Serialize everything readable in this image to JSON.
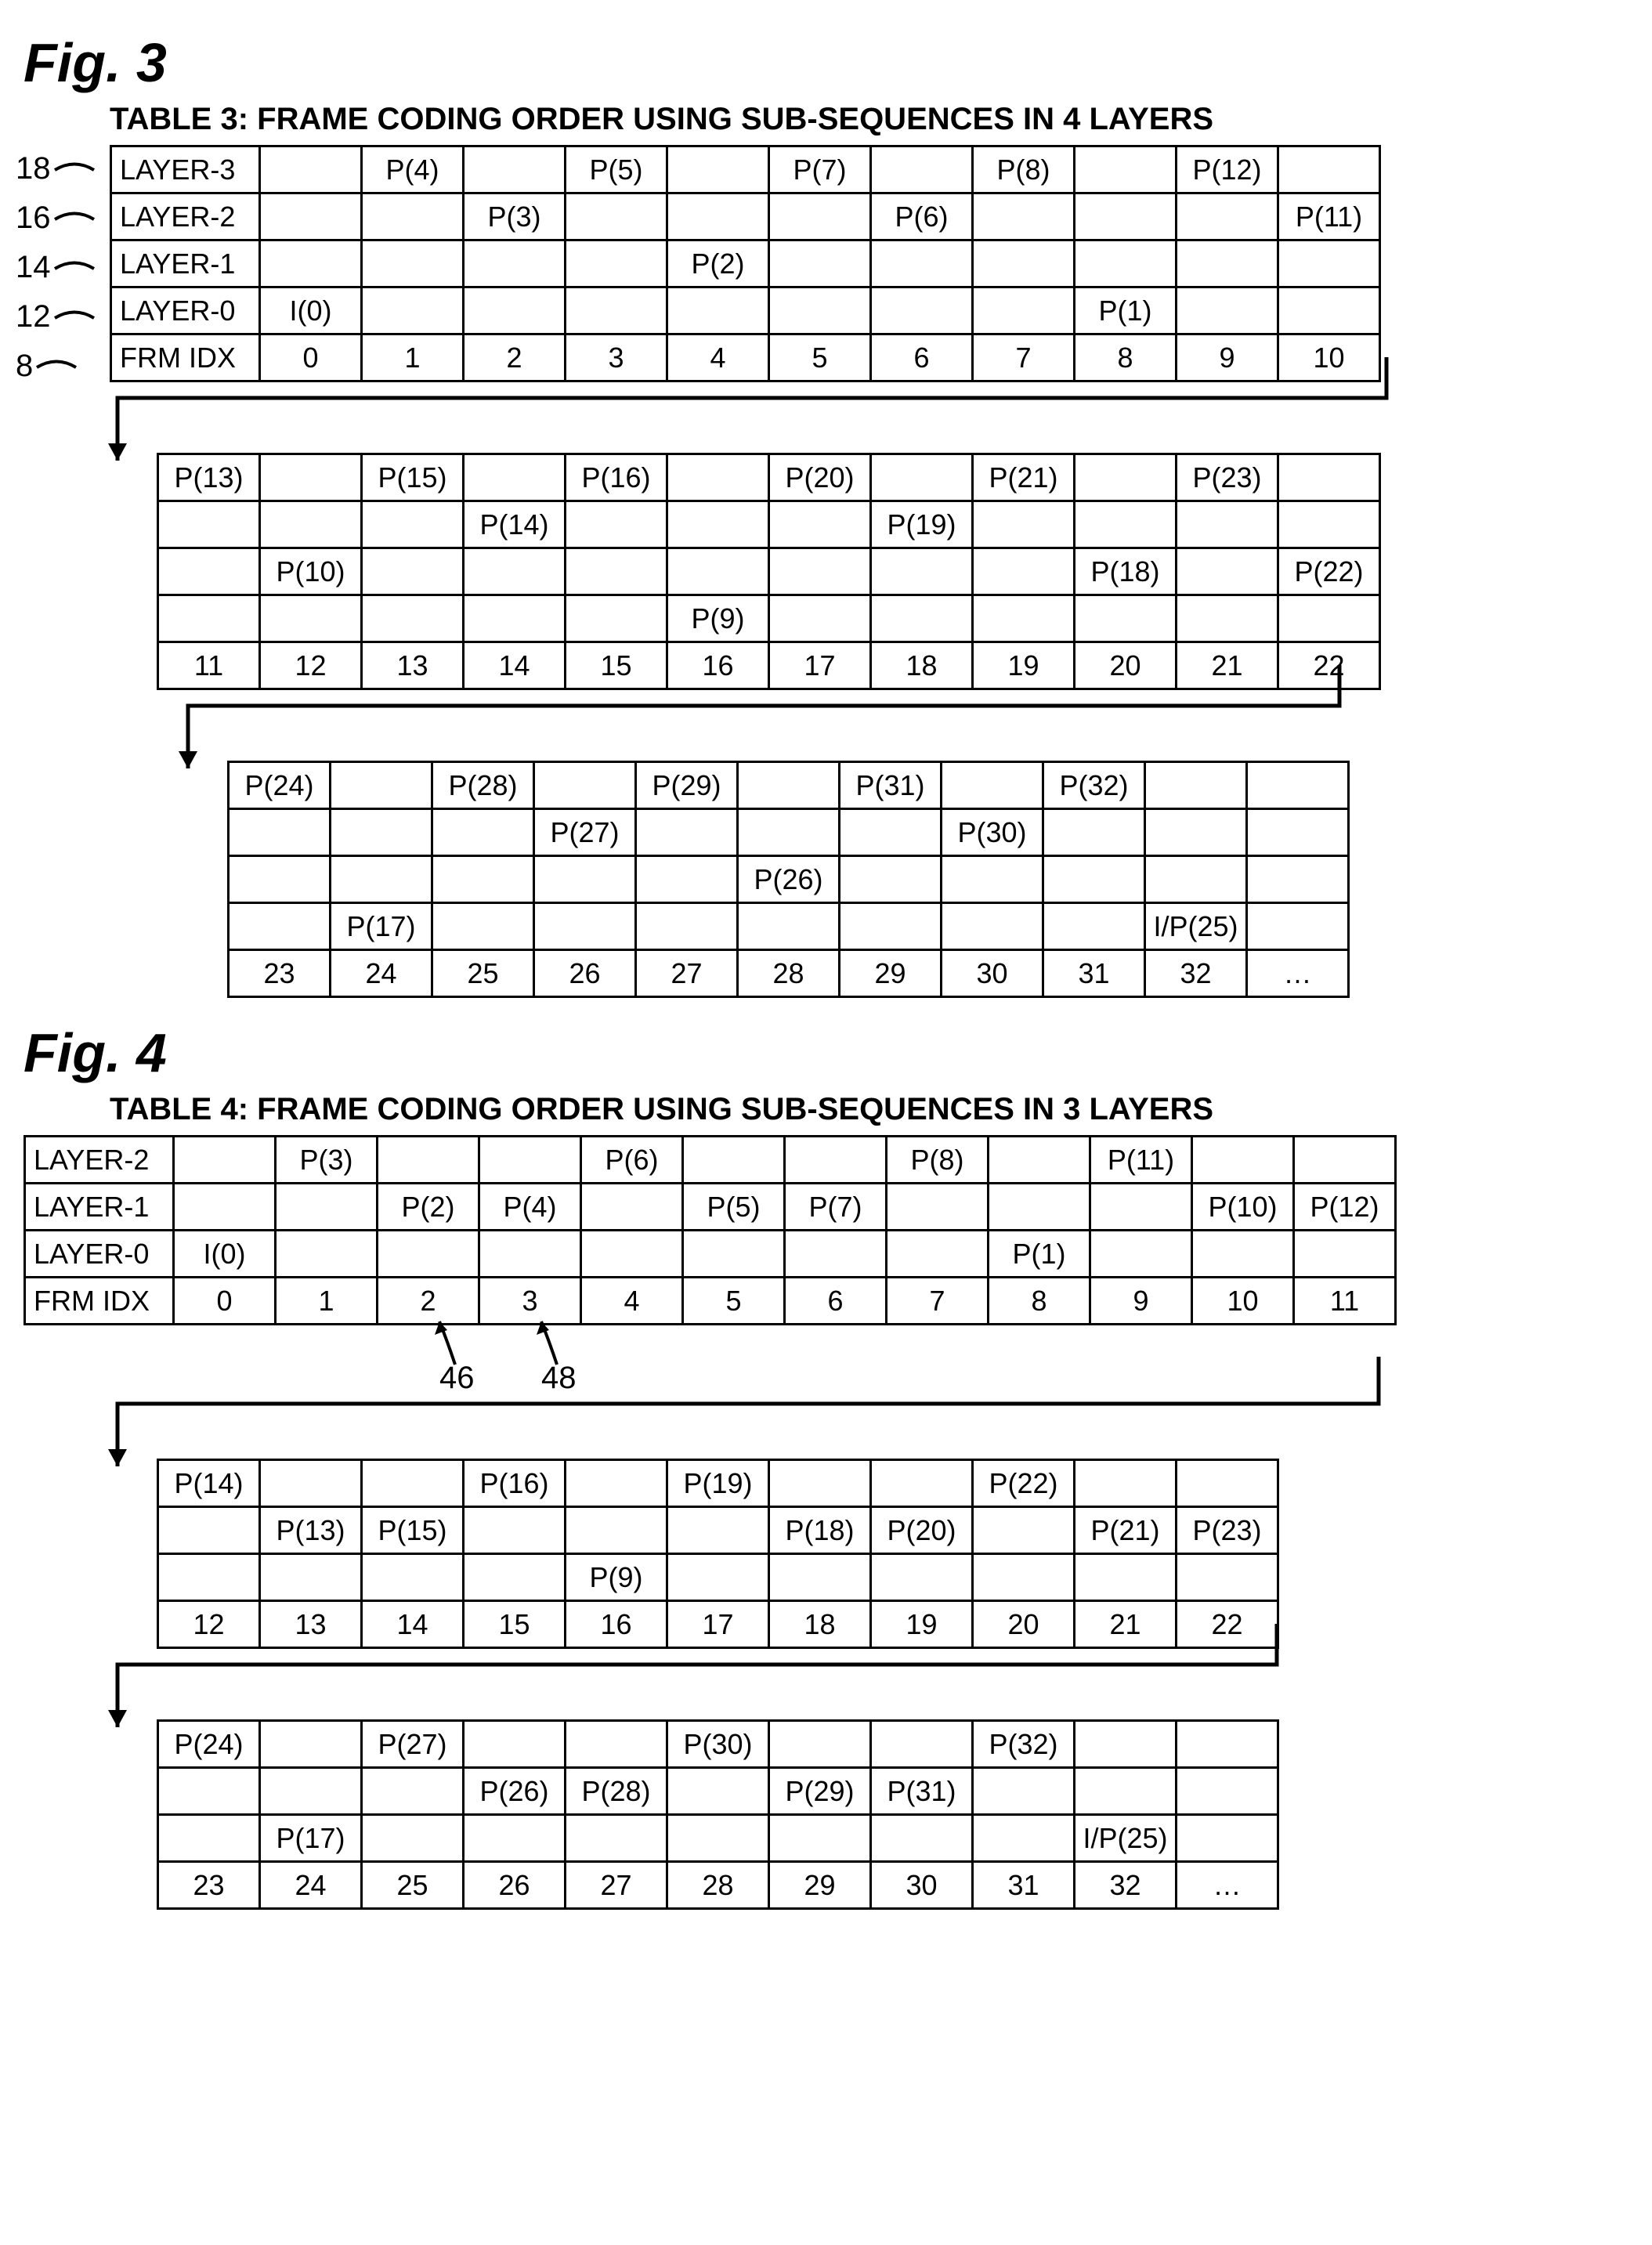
{
  "figures": [
    {
      "id": "fig3",
      "fig_label": "Fig. 3",
      "table_title": "TABLE 3: FRAME CODING ORDER USING SUB-SEQUENCES IN 4 LAYERS",
      "row_header_labels": [
        "LAYER-3",
        "LAYER-2",
        "LAYER-1",
        "LAYER-0",
        "FRM IDX"
      ],
      "left_refs": [
        {
          "num": "18",
          "row": 0
        },
        {
          "num": "16",
          "row": 1
        },
        {
          "num": "14",
          "row": 2
        },
        {
          "num": "12",
          "row": 3
        },
        {
          "num": "8",
          "row": 4
        }
      ],
      "blocks": [
        {
          "show_row_headers": true,
          "columns": 11,
          "rows": [
            [
              "",
              "P(4)",
              "",
              "P(5)",
              "",
              "P(7)",
              "",
              "P(8)",
              "",
              "P(12)",
              ""
            ],
            [
              "",
              "",
              "P(3)",
              "",
              "",
              "",
              "P(6)",
              "",
              "",
              "",
              "P(11)"
            ],
            [
              "",
              "",
              "",
              "",
              "P(2)",
              "",
              "",
              "",
              "",
              "",
              ""
            ],
            [
              "I(0)",
              "",
              "",
              "",
              "",
              "",
              "",
              "",
              "P(1)",
              "",
              ""
            ],
            [
              "0",
              "1",
              "2",
              "3",
              "4",
              "5",
              "6",
              "7",
              "8",
              "9",
              "10"
            ]
          ]
        },
        {
          "show_row_headers": false,
          "columns": 12,
          "rows": [
            [
              "P(13)",
              "",
              "P(15)",
              "",
              "P(16)",
              "",
              "P(20)",
              "",
              "P(21)",
              "",
              "P(23)",
              ""
            ],
            [
              "",
              "",
              "",
              "P(14)",
              "",
              "",
              "",
              "P(19)",
              "",
              "",
              "",
              ""
            ],
            [
              "",
              "P(10)",
              "",
              "",
              "",
              "",
              "",
              "",
              "",
              "P(18)",
              "",
              "P(22)"
            ],
            [
              "",
              "",
              "",
              "",
              "",
              "P(9)",
              "",
              "",
              "",
              "",
              "",
              ""
            ],
            [
              "11",
              "12",
              "13",
              "14",
              "15",
              "16",
              "17",
              "18",
              "19",
              "20",
              "21",
              "22"
            ]
          ]
        },
        {
          "show_row_headers": false,
          "columns": 11,
          "rows": [
            [
              "P(24)",
              "",
              "P(28)",
              "",
              "P(29)",
              "",
              "P(31)",
              "",
              "P(32)",
              "",
              ""
            ],
            [
              "",
              "",
              "",
              "P(27)",
              "",
              "",
              "",
              "P(30)",
              "",
              "",
              ""
            ],
            [
              "",
              "",
              "",
              "",
              "",
              "P(26)",
              "",
              "",
              "",
              "",
              ""
            ],
            [
              "",
              "P(17)",
              "",
              "",
              "",
              "",
              "",
              "",
              "",
              "I/P(25)",
              ""
            ],
            [
              "23",
              "24",
              "25",
              "26",
              "27",
              "28",
              "29",
              "30",
              "31",
              "32",
              "…"
            ]
          ]
        }
      ],
      "chart_data": {
        "type": "table",
        "description": "Frame coding order across 4 layers; FRM IDX 0..32",
        "frames": [
          {
            "idx": 0,
            "layer": 0,
            "code": "I(0)"
          },
          {
            "idx": 1,
            "layer": 3,
            "code": "P(4)"
          },
          {
            "idx": 2,
            "layer": 2,
            "code": "P(3)"
          },
          {
            "idx": 3,
            "layer": 3,
            "code": "P(5)"
          },
          {
            "idx": 4,
            "layer": 1,
            "code": "P(2)"
          },
          {
            "idx": 5,
            "layer": 3,
            "code": "P(7)"
          },
          {
            "idx": 6,
            "layer": 2,
            "code": "P(6)"
          },
          {
            "idx": 7,
            "layer": 3,
            "code": "P(8)"
          },
          {
            "idx": 8,
            "layer": 0,
            "code": "P(1)"
          },
          {
            "idx": 9,
            "layer": 3,
            "code": "P(12)"
          },
          {
            "idx": 10,
            "layer": 2,
            "code": "P(11)"
          },
          {
            "idx": 11,
            "layer": 3,
            "code": "P(13)"
          },
          {
            "idx": 12,
            "layer": 1,
            "code": "P(10)"
          },
          {
            "idx": 13,
            "layer": 3,
            "code": "P(15)"
          },
          {
            "idx": 14,
            "layer": 2,
            "code": "P(14)"
          },
          {
            "idx": 15,
            "layer": 3,
            "code": "P(16)"
          },
          {
            "idx": 16,
            "layer": 0,
            "code": "P(9)"
          },
          {
            "idx": 17,
            "layer": 3,
            "code": "P(20)"
          },
          {
            "idx": 18,
            "layer": 2,
            "code": "P(19)"
          },
          {
            "idx": 19,
            "layer": 3,
            "code": "P(21)"
          },
          {
            "idx": 20,
            "layer": 1,
            "code": "P(18)"
          },
          {
            "idx": 21,
            "layer": 3,
            "code": "P(23)"
          },
          {
            "idx": 22,
            "layer": 1,
            "code": "P(22)"
          },
          {
            "idx": 23,
            "layer": 3,
            "code": "P(24)"
          },
          {
            "idx": 24,
            "layer": 0,
            "code": "P(17)"
          },
          {
            "idx": 25,
            "layer": 3,
            "code": "P(28)"
          },
          {
            "idx": 26,
            "layer": 2,
            "code": "P(27)"
          },
          {
            "idx": 27,
            "layer": 3,
            "code": "P(29)"
          },
          {
            "idx": 28,
            "layer": 1,
            "code": "P(26)"
          },
          {
            "idx": 29,
            "layer": 3,
            "code": "P(31)"
          },
          {
            "idx": 30,
            "layer": 2,
            "code": "P(30)"
          },
          {
            "idx": 31,
            "layer": 3,
            "code": "P(32)"
          },
          {
            "idx": 32,
            "layer": 0,
            "code": "I/P(25)"
          }
        ]
      }
    },
    {
      "id": "fig4",
      "fig_label": "Fig. 4",
      "table_title": "TABLE 4: FRAME CODING ORDER USING SUB-SEQUENCES IN 3 LAYERS",
      "row_header_labels": [
        "LAYER-2",
        "LAYER-1",
        "LAYER-0",
        "FRM IDX"
      ],
      "below_refs": [
        {
          "num": "46",
          "col": 2
        },
        {
          "num": "48",
          "col": 3
        }
      ],
      "blocks": [
        {
          "show_row_headers": true,
          "columns": 12,
          "rows": [
            [
              "",
              "P(3)",
              "",
              "",
              "P(6)",
              "",
              "",
              "P(8)",
              "",
              "P(11)",
              "",
              ""
            ],
            [
              "",
              "",
              "P(2)",
              "P(4)",
              "",
              "P(5)",
              "P(7)",
              "",
              "",
              "",
              "P(10)",
              "P(12)"
            ],
            [
              "I(0)",
              "",
              "",
              "",
              "",
              "",
              "",
              "",
              "P(1)",
              "",
              "",
              ""
            ],
            [
              "0",
              "1",
              "2",
              "3",
              "4",
              "5",
              "6",
              "7",
              "8",
              "9",
              "10",
              "11"
            ]
          ]
        },
        {
          "show_row_headers": false,
          "columns": 11,
          "rows": [
            [
              "P(14)",
              "",
              "",
              "P(16)",
              "",
              "P(19)",
              "",
              "",
              "P(22)",
              "",
              ""
            ],
            [
              "",
              "P(13)",
              "P(15)",
              "",
              "",
              "",
              "P(18)",
              "P(20)",
              "",
              "P(21)",
              "P(23)"
            ],
            [
              "",
              "",
              "",
              "",
              "P(9)",
              "",
              "",
              "",
              "",
              "",
              ""
            ],
            [
              "12",
              "13",
              "14",
              "15",
              "16",
              "17",
              "18",
              "19",
              "20",
              "21",
              "22"
            ]
          ]
        },
        {
          "show_row_headers": false,
          "columns": 11,
          "rows": [
            [
              "P(24)",
              "",
              "P(27)",
              "",
              "",
              "P(30)",
              "",
              "",
              "P(32)",
              "",
              ""
            ],
            [
              "",
              "",
              "",
              "P(26)",
              "P(28)",
              "",
              "P(29)",
              "P(31)",
              "",
              "",
              ""
            ],
            [
              "",
              "P(17)",
              "",
              "",
              "",
              "",
              "",
              "",
              "",
              "I/P(25)",
              ""
            ],
            [
              "23",
              "24",
              "25",
              "26",
              "27",
              "28",
              "29",
              "30",
              "31",
              "32",
              "…"
            ]
          ]
        }
      ],
      "chart_data": {
        "type": "table",
        "description": "Frame coding order across 3 layers; FRM IDX 0..32",
        "frames": [
          {
            "idx": 0,
            "layer": 0,
            "code": "I(0)"
          },
          {
            "idx": 1,
            "layer": 2,
            "code": "P(3)"
          },
          {
            "idx": 2,
            "layer": 1,
            "code": "P(2)"
          },
          {
            "idx": 3,
            "layer": 1,
            "code": "P(4)"
          },
          {
            "idx": 4,
            "layer": 2,
            "code": "P(6)"
          },
          {
            "idx": 5,
            "layer": 1,
            "code": "P(5)"
          },
          {
            "idx": 6,
            "layer": 1,
            "code": "P(7)"
          },
          {
            "idx": 7,
            "layer": 2,
            "code": "P(8)"
          },
          {
            "idx": 8,
            "layer": 0,
            "code": "P(1)"
          },
          {
            "idx": 9,
            "layer": 2,
            "code": "P(11)"
          },
          {
            "idx": 10,
            "layer": 1,
            "code": "P(10)"
          },
          {
            "idx": 11,
            "layer": 1,
            "code": "P(12)"
          },
          {
            "idx": 12,
            "layer": 2,
            "code": "P(14)"
          },
          {
            "idx": 13,
            "layer": 1,
            "code": "P(13)"
          },
          {
            "idx": 14,
            "layer": 1,
            "code": "P(15)"
          },
          {
            "idx": 15,
            "layer": 2,
            "code": "P(16)"
          },
          {
            "idx": 16,
            "layer": 0,
            "code": "P(9)"
          },
          {
            "idx": 17,
            "layer": 2,
            "code": "P(19)"
          },
          {
            "idx": 18,
            "layer": 1,
            "code": "P(18)"
          },
          {
            "idx": 19,
            "layer": 1,
            "code": "P(20)"
          },
          {
            "idx": 20,
            "layer": 2,
            "code": "P(22)"
          },
          {
            "idx": 21,
            "layer": 1,
            "code": "P(21)"
          },
          {
            "idx": 22,
            "layer": 1,
            "code": "P(23)"
          },
          {
            "idx": 23,
            "layer": 2,
            "code": "P(24)"
          },
          {
            "idx": 24,
            "layer": 0,
            "code": "P(17)"
          },
          {
            "idx": 25,
            "layer": 2,
            "code": "P(27)"
          },
          {
            "idx": 26,
            "layer": 1,
            "code": "P(26)"
          },
          {
            "idx": 27,
            "layer": 1,
            "code": "P(28)"
          },
          {
            "idx": 28,
            "layer": 2,
            "code": "P(30)"
          },
          {
            "idx": 29,
            "layer": 1,
            "code": "P(29)"
          },
          {
            "idx": 30,
            "layer": 1,
            "code": "P(31)"
          },
          {
            "idx": 31,
            "layer": 2,
            "code": "P(32)"
          },
          {
            "idx": 32,
            "layer": 0,
            "code": "I/P(25)"
          }
        ]
      }
    }
  ]
}
